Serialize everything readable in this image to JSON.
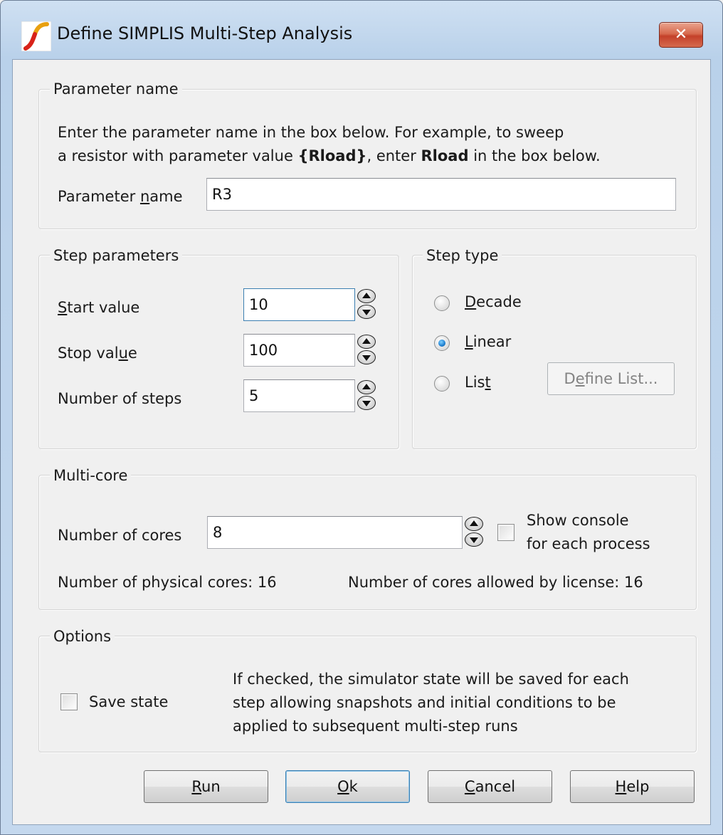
{
  "window": {
    "title": "Define SIMPLIS Multi-Step Analysis",
    "close_label": "✕",
    "icon": "simplis-logo-icon"
  },
  "parameter_name_group": {
    "legend": "Parameter name",
    "instructions_line1": "Enter the parameter name in the box below. For example, to sweep",
    "instructions_line2_part1": "a resistor with parameter value ",
    "instructions_line2_bold1": "{Rload}",
    "instructions_line2_part2": ", enter ",
    "instructions_line2_bold2": "Rload",
    "instructions_line2_part3": " in the box below.",
    "field_label_pre": "Parameter ",
    "field_label_mnemonic": "n",
    "field_label_post": "ame",
    "value": "R3"
  },
  "step_parameters": {
    "legend": "Step parameters",
    "start_label_mnemonic": "S",
    "start_label_post": "tart value",
    "start_value": "10",
    "stop_label_pre": "Stop val",
    "stop_label_mnemonic": "u",
    "stop_label_post": "e",
    "stop_value": "100",
    "steps_label": "Number of steps",
    "steps_value": "5"
  },
  "step_type": {
    "legend": "Step type",
    "decade_mnemonic": "D",
    "decade_post": "ecade",
    "linear_mnemonic": "L",
    "linear_post": "inear",
    "list_pre": "Lis",
    "list_mnemonic": "t",
    "selected": "Linear",
    "define_list_pre": "D",
    "define_list_mnemonic": "e",
    "define_list_post": "fine List..."
  },
  "multicore": {
    "legend": "Multi-core",
    "cores_label": "Number of cores",
    "cores_value": "8",
    "show_console_line1": "Show console",
    "show_console_line2": "for each process",
    "physical_cores": "Number of physical cores: 16",
    "license_cores": "Number of cores allowed by license: 16"
  },
  "options": {
    "legend": "Options",
    "save_state_label": "Save state",
    "description_line1": "If checked, the simulator state will be saved for each",
    "description_line2": "step allowing snapshots and initial conditions to be",
    "description_line3": "applied to subsequent multi-step runs"
  },
  "buttons": {
    "run_mnemonic": "R",
    "run_post": "un",
    "ok_mnemonic": "O",
    "ok_post": "k",
    "cancel_mnemonic": "C",
    "cancel_post": "ancel",
    "help_mnemonic": "H",
    "help_post": "elp"
  }
}
